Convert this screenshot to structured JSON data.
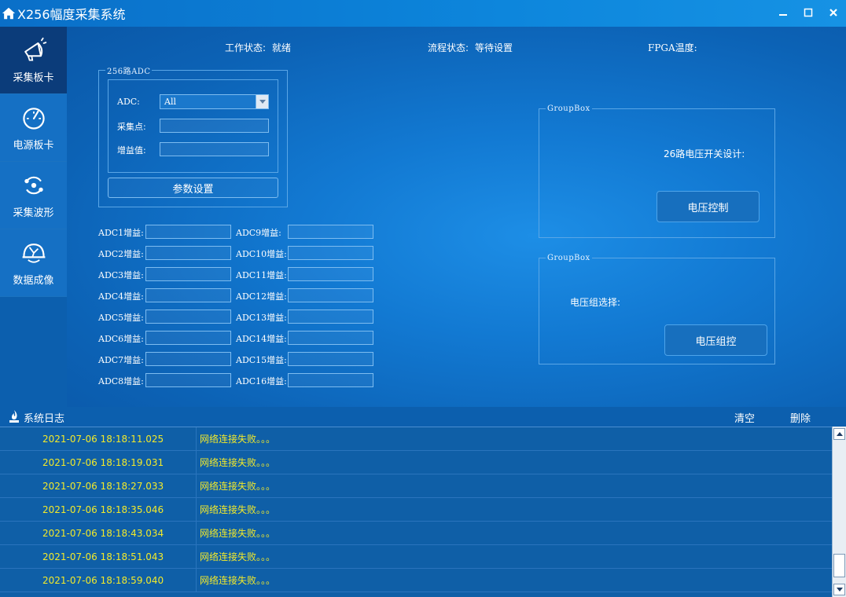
{
  "window": {
    "title": "X256幅度采集系统",
    "controls": {
      "minimize": "▬",
      "maximize": "☐",
      "close": "✖"
    }
  },
  "sidebar": {
    "items": [
      {
        "label": "采集板卡",
        "icon": "megaphone-icon",
        "active": true
      },
      {
        "label": "电源板卡",
        "icon": "gauge-icon",
        "active": false
      },
      {
        "label": "采集波形",
        "icon": "cycle-icon",
        "active": false
      },
      {
        "label": "数据成像",
        "icon": "helmet-icon",
        "active": false
      }
    ]
  },
  "status": {
    "work_label": "工作状态:",
    "work_value": "就绪",
    "flow_label": "流程状态:",
    "flow_value": "等待设置",
    "fpga_label": "FPGA温度:",
    "fpga_value": ""
  },
  "adc_group": {
    "legend": "256路ADC",
    "adc_label": "ADC:",
    "adc_selected": "All",
    "sample_label": "采集点:",
    "sample_value": "",
    "gain_label": "增益值:",
    "gain_value": "",
    "param_button": "参数设置"
  },
  "gains": {
    "left": [
      "ADC1增益:",
      "ADC2增益:",
      "ADC3增益:",
      "ADC4增益:",
      "ADC5增益:",
      "ADC6增益:",
      "ADC7增益:",
      "ADC8增益:"
    ],
    "right": [
      "ADC9增益:",
      "ADC10增益:",
      "ADC11增益:",
      "ADC12增益:",
      "ADC13增益:",
      "ADC14增益:",
      "ADC15增益:",
      "ADC16增益:"
    ]
  },
  "group1": {
    "legend": "GroupBox",
    "text": "26路电压开关设计:",
    "button": "电压控制"
  },
  "group2": {
    "legend": "GroupBox",
    "text": "电压组选择:",
    "button": "电压组控"
  },
  "log": {
    "title": "系统日志",
    "clear": "清空",
    "delete": "删除",
    "rows": [
      {
        "time": "2021-07-06 18:18:11.025",
        "msg": "网络连接失败。。。"
      },
      {
        "time": "2021-07-06 18:18:19.031",
        "msg": "网络连接失败。。。"
      },
      {
        "time": "2021-07-06 18:18:27.033",
        "msg": "网络连接失败。。。"
      },
      {
        "time": "2021-07-06 18:18:35.046",
        "msg": "网络连接失败。。。"
      },
      {
        "time": "2021-07-06 18:18:43.034",
        "msg": "网络连接失败。。。"
      },
      {
        "time": "2021-07-06 18:18:51.043",
        "msg": "网络连接失败。。。"
      },
      {
        "time": "2021-07-06 18:18:59.040",
        "msg": "网络连接失败。。。"
      }
    ]
  }
}
